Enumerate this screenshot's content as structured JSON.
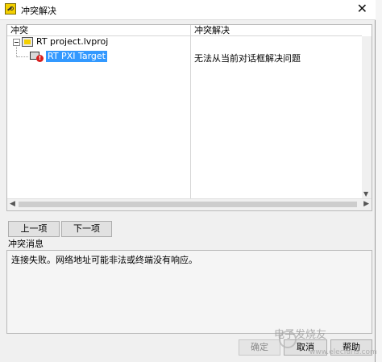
{
  "window": {
    "title": "冲突解决",
    "close_glyph": "✕"
  },
  "tree": {
    "columns": [
      "冲突",
      "冲突解决"
    ],
    "project": {
      "label": "RT project.lvproj"
    },
    "target": {
      "label": "RT PXI Target",
      "badge": "!",
      "resolution": "无法从当前对话框解决问题"
    }
  },
  "nav": {
    "prev": "上一项",
    "next": "下一项"
  },
  "message": {
    "label": "冲突消息",
    "text": "连接失败。网络地址可能非法或终端没有响应。"
  },
  "footer": {
    "ok": "确定",
    "cancel": "取消",
    "help": "帮助"
  },
  "watermark": {
    "text": "电子发烧友",
    "url": "www.elecfans.com"
  },
  "icons": [
    "app-icon",
    "close-icon",
    "collapse-icon",
    "project-icon",
    "target-icon",
    "error-icon"
  ]
}
